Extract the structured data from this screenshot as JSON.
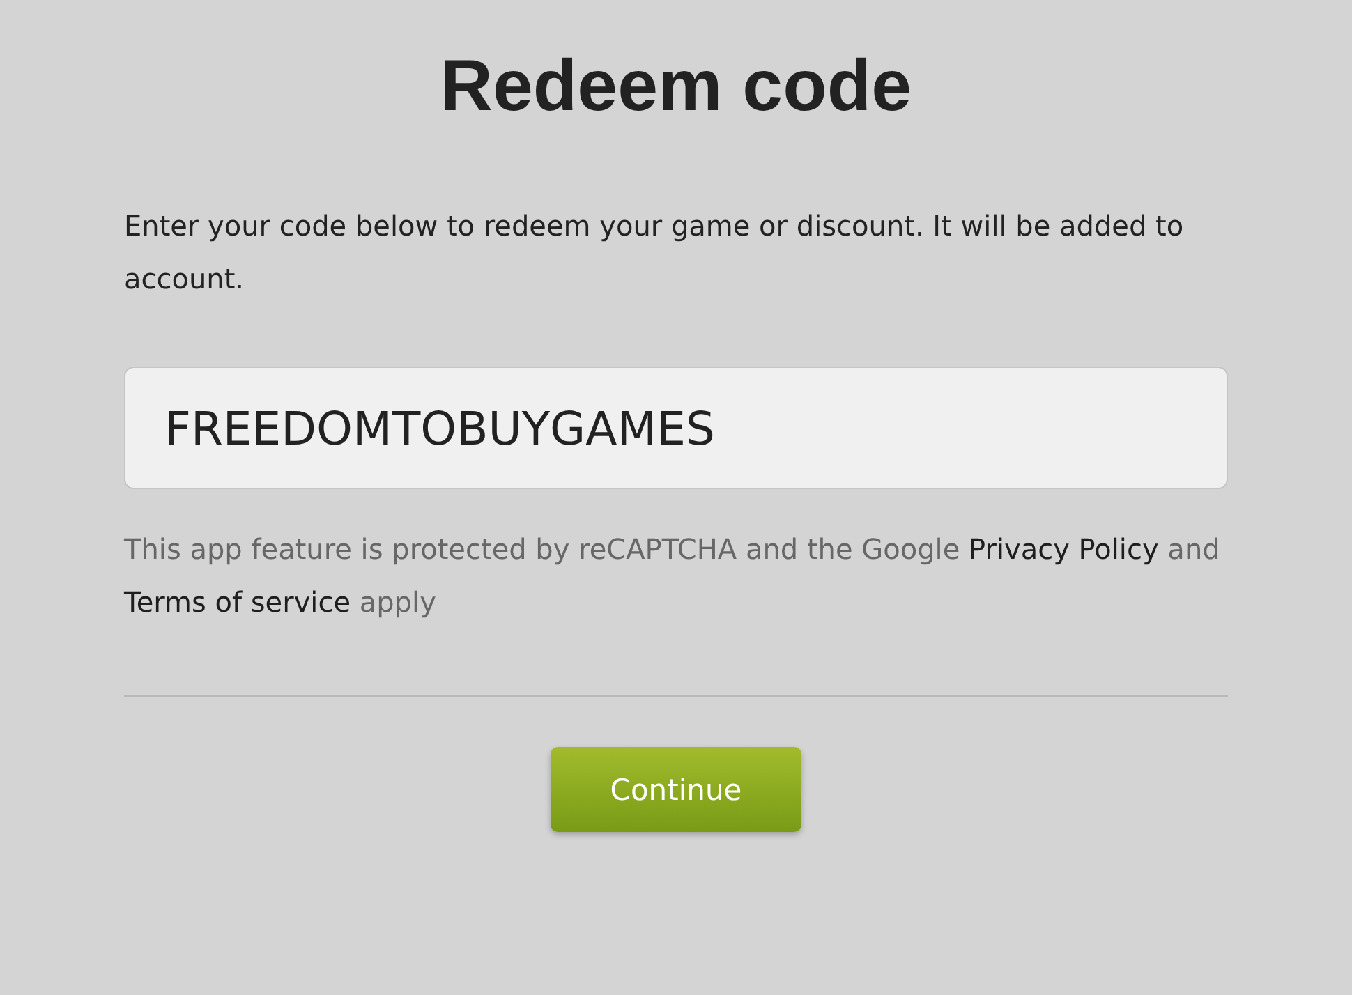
{
  "title": "Redeem code",
  "intro": "Enter your code below to redeem your game or discount. It will be added to account.",
  "code_field": {
    "value": "FREEDOMTOBUYGAMES"
  },
  "notice": [
    {
      "kind": "text",
      "text": "This app feature is protected by reCAPTCHA and the Google "
    },
    {
      "kind": "link",
      "text": "Privacy Policy"
    },
    {
      "kind": "text",
      "text": " and "
    },
    {
      "kind": "link",
      "text": "Terms of service"
    },
    {
      "kind": "text",
      "text": " apply"
    }
  ],
  "button": "Continue"
}
